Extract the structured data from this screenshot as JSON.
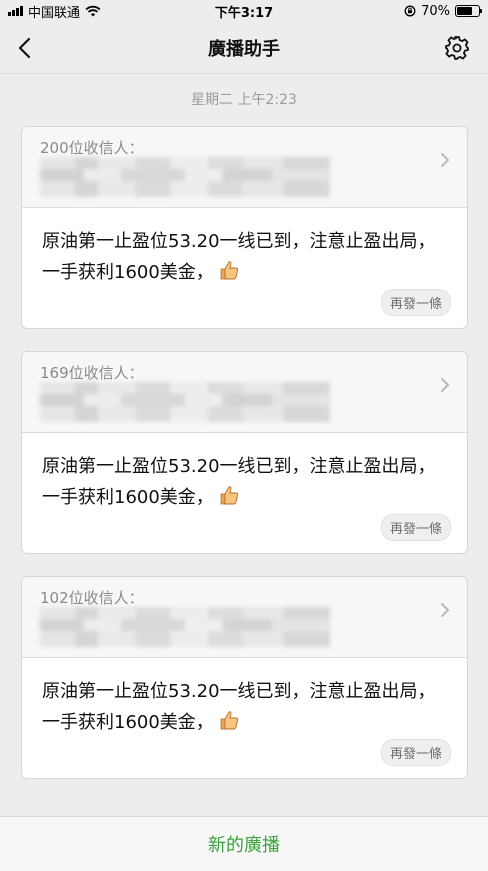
{
  "status_bar": {
    "carrier": "中国联通",
    "time": "下午3:17",
    "battery_percent": "70%",
    "battery_level": 0.7,
    "icons": [
      "signal-icon",
      "wifi-icon",
      "rotation-lock-icon",
      "battery-icon"
    ]
  },
  "nav": {
    "title": "廣播助手",
    "back_icon": "chevron-left-icon",
    "settings_icon": "gear-icon"
  },
  "timestamp": "星期二 上午2:23",
  "broadcasts": [
    {
      "recipients_label": "200位收信人：",
      "message": "原油第一止盈位53.20一线已到，注意止盈出局，一手获利1600美金，",
      "resend_label": "再發一條"
    },
    {
      "recipients_label": "169位收信人：",
      "message": "原油第一止盈位53.20一线已到，注意止盈出局，一手获利1600美金，",
      "resend_label": "再發一條"
    },
    {
      "recipients_label": "102位收信人：",
      "message": "原油第一止盈位53.20一线已到，注意止盈出局，一手获利1600美金，",
      "resend_label": "再發一條"
    }
  ],
  "bottom": {
    "new_broadcast_label": "新的廣播",
    "accent_color": "#3aa33a"
  }
}
